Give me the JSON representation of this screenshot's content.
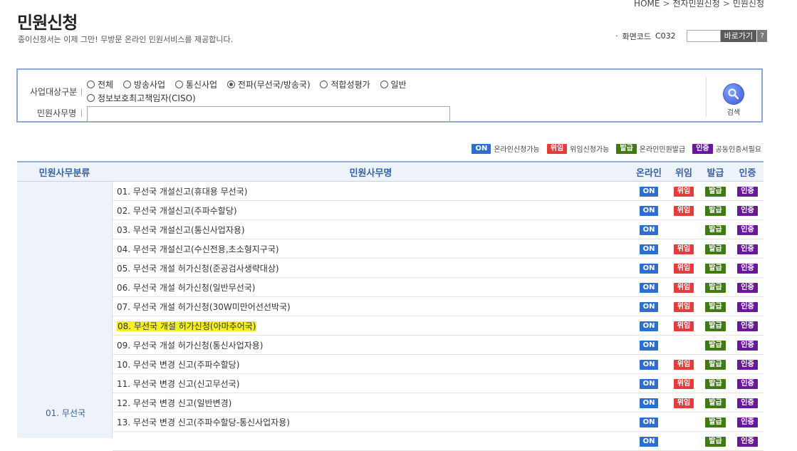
{
  "breadcrumb": [
    "HOME",
    "전자민원신청",
    "민원신청"
  ],
  "title": "민원신청",
  "subtitle": "종이신청서는 이제 그만! 무방문 온라인 민원서비스를 제공합니다.",
  "screen_code": {
    "label": "화면코드",
    "code": "C032",
    "input_value": "",
    "go_label": "바로가기",
    "help_label": "?"
  },
  "search": {
    "category_label": "사업대상구분",
    "options": [
      "전체",
      "방송사업",
      "통신사업",
      "전파(무선국/방송국)",
      "적합성평가",
      "일반",
      "정보보호최고책임자(CISO)"
    ],
    "selected": "전파(무선국/방송국)",
    "name_label": "민원사무명",
    "name_value": "",
    "button_label": "검색"
  },
  "legend": [
    {
      "badge": "ON",
      "text": "온라인신청가능",
      "color": "#2c6fd0"
    },
    {
      "badge": "위임",
      "text": "위임신청가능",
      "color": "#e23c3c"
    },
    {
      "badge": "발급",
      "text": "온라인민원발급",
      "color": "#3f7a14"
    },
    {
      "badge": "인증",
      "text": "공동인증서필요",
      "color": "#6a1799"
    }
  ],
  "table": {
    "headers": [
      "민원사무분류",
      "민원사무명",
      "온라인",
      "위임",
      "발급",
      "인증"
    ],
    "category": "01. 무선국",
    "badge_labels": {
      "on": "ON",
      "wi": "위임",
      "bal": "발급",
      "in": "인증"
    },
    "rows": [
      {
        "name": "01. 무선국 개설신고(휴대용 무선국)",
        "on": true,
        "wi": true,
        "bal": true,
        "in": true,
        "highlight": false
      },
      {
        "name": "02. 무선국 개설신고(주파수할당)",
        "on": true,
        "wi": true,
        "bal": true,
        "in": true,
        "highlight": false
      },
      {
        "name": "03. 무선국 개설신고(통신사업자용)",
        "on": true,
        "wi": false,
        "bal": true,
        "in": true,
        "highlight": false
      },
      {
        "name": "04. 무선국 개설신고(수신전용,초소형지구국)",
        "on": true,
        "wi": true,
        "bal": true,
        "in": true,
        "highlight": false
      },
      {
        "name": "05. 무선국 개설 허가신청(준공검사생략대상)",
        "on": true,
        "wi": true,
        "bal": true,
        "in": true,
        "highlight": false
      },
      {
        "name": "06. 무선국 개설 허가신청(일반무선국)",
        "on": true,
        "wi": true,
        "bal": true,
        "in": true,
        "highlight": false
      },
      {
        "name": "07. 무선국 개설 허가신청(30W미만어선선박국)",
        "on": true,
        "wi": true,
        "bal": true,
        "in": true,
        "highlight": false
      },
      {
        "name": "08. 무선국 개설 허가신청(아마추어국)",
        "on": true,
        "wi": true,
        "bal": true,
        "in": true,
        "highlight": true
      },
      {
        "name": "09. 무선국 개설 허가신청(통신사업자용)",
        "on": true,
        "wi": false,
        "bal": true,
        "in": true,
        "highlight": false
      },
      {
        "name": "10. 무선국 변경 신고(주파수할당)",
        "on": true,
        "wi": true,
        "bal": true,
        "in": true,
        "highlight": false
      },
      {
        "name": "11. 무선국 변경 신고(신고무선국)",
        "on": true,
        "wi": true,
        "bal": true,
        "in": true,
        "highlight": false
      },
      {
        "name": "12. 무선국 변경 신고(일반변경)",
        "on": true,
        "wi": true,
        "bal": true,
        "in": true,
        "highlight": false
      },
      {
        "name": "13. 무선국 변경 신고(주파수할당-통신사업자용)",
        "on": true,
        "wi": false,
        "bal": true,
        "in": true,
        "highlight": false
      },
      {
        "name": "",
        "on": true,
        "wi": false,
        "bal": true,
        "in": true,
        "highlight": false
      }
    ]
  }
}
